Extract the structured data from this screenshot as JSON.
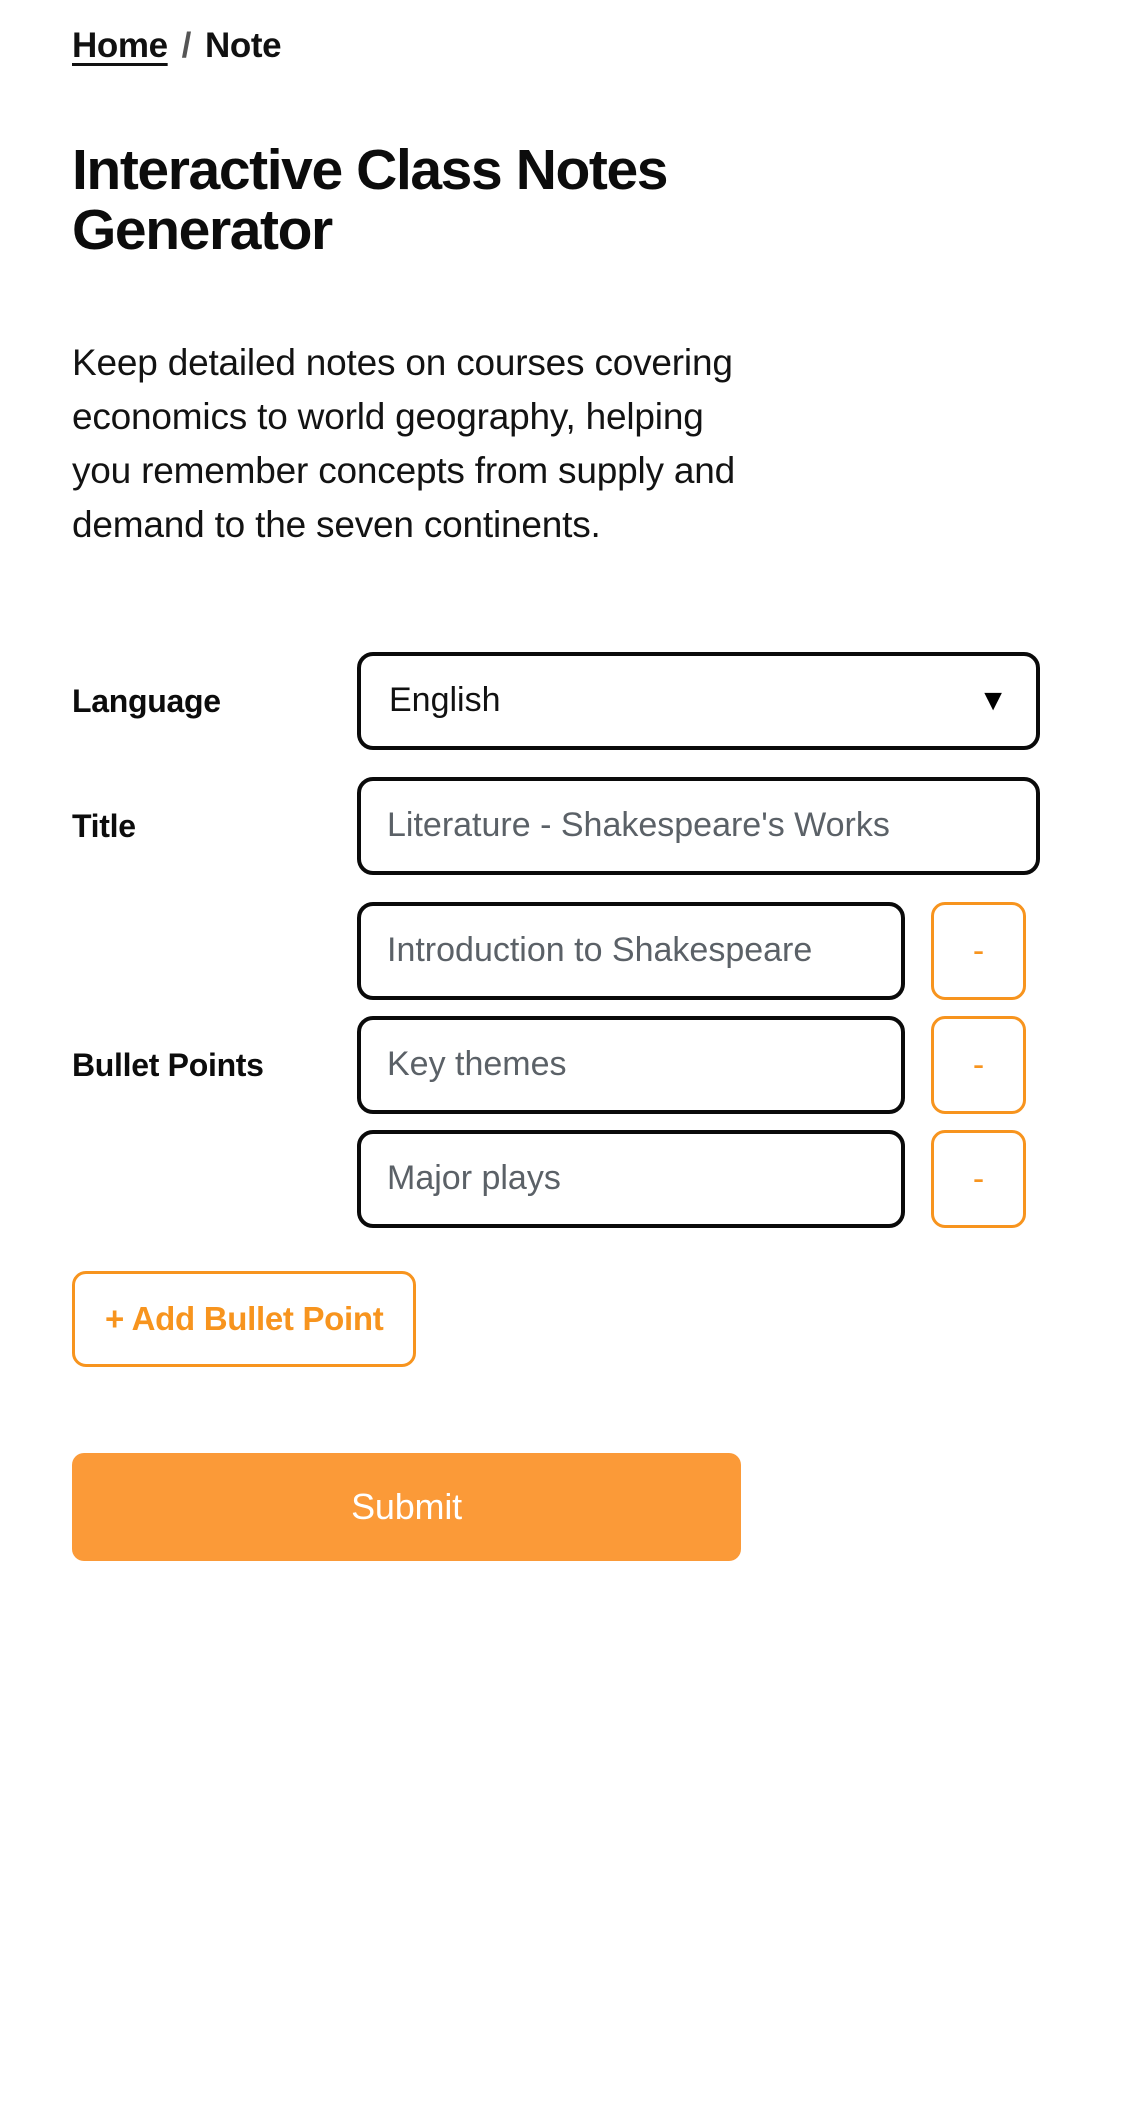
{
  "breadcrumb": {
    "home_label": "Home",
    "separator": "/",
    "current_label": "Note"
  },
  "header": {
    "title": "Interactive Class Notes Generator",
    "description": "Keep detailed notes on courses covering economics to world geography, helping you remember concepts from supply and demand to the seven continents."
  },
  "form": {
    "language": {
      "label": "Language",
      "selected": "English",
      "caret": "▼"
    },
    "title": {
      "label": "Title",
      "value": "",
      "placeholder": "Literature - Shakespeare's Works"
    },
    "bullet_points": {
      "label": "Bullet Points",
      "items": [
        {
          "value": "",
          "placeholder": "Introduction to Shakespeare",
          "remove_label": "-"
        },
        {
          "value": "",
          "placeholder": "Key themes",
          "remove_label": "-"
        },
        {
          "value": "",
          "placeholder": "Major plays",
          "remove_label": "-"
        }
      ],
      "add_label": "+ Add Bullet Point"
    },
    "submit_label": "Submit"
  },
  "colors": {
    "accent_orange": "#f7941e",
    "submit_orange": "#fb9a38",
    "border_black": "#0a0a0a",
    "placeholder_gray": "#5b6167"
  }
}
